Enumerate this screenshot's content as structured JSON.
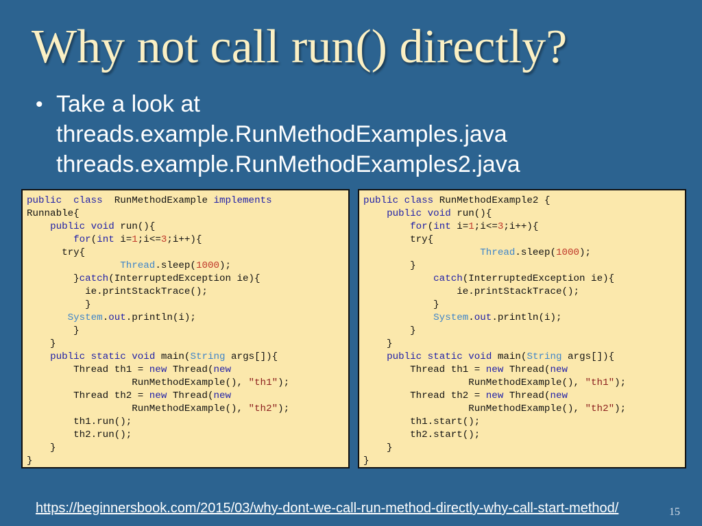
{
  "slide": {
    "title": "Why not call run() directly?",
    "bullet": {
      "lines": [
        "Take a look at",
        "threads.example.RunMethodExamples.java",
        "threads.example.RunMethodExamples2.java"
      ]
    },
    "footer_link": "https://beginnersbook.com/2015/03/why-dont-we-call-run-method-directly-why-call-start-method/",
    "page_number": "15"
  },
  "code_left": [
    [
      [
        "kw",
        "public"
      ],
      [
        "",
        "  "
      ],
      [
        "kw",
        "class"
      ],
      [
        "",
        "  RunMethodExample "
      ],
      [
        "kw",
        "implements"
      ]
    ],
    [
      [
        "",
        "Runnable{"
      ]
    ],
    [
      [
        "",
        "    "
      ],
      [
        "kw",
        "public"
      ],
      [
        "",
        " "
      ],
      [
        "kw",
        "void"
      ],
      [
        "",
        " run(){"
      ]
    ],
    [
      [
        "",
        "        "
      ],
      [
        "kw",
        "for"
      ],
      [
        "",
        "("
      ],
      [
        "kw",
        "int"
      ],
      [
        "",
        " i="
      ],
      [
        "num",
        "1"
      ],
      [
        "",
        ";i<="
      ],
      [
        "num",
        "3"
      ],
      [
        "",
        ";i++){"
      ]
    ],
    [
      [
        "",
        "      try{"
      ]
    ],
    [
      [
        "",
        "                "
      ],
      [
        "tp",
        "Thread"
      ],
      [
        "",
        ".sleep("
      ],
      [
        "num",
        "1000"
      ],
      [
        "",
        ");"
      ]
    ],
    [
      [
        "",
        "        }"
      ],
      [
        "kw",
        "catch"
      ],
      [
        "",
        "(InterruptedException ie){"
      ]
    ],
    [
      [
        "",
        "          ie.printStackTrace();"
      ]
    ],
    [
      [
        "",
        "          }"
      ]
    ],
    [
      [
        "",
        "       "
      ],
      [
        "tp",
        "System"
      ],
      [
        "",
        "."
      ],
      [
        "fld",
        "out"
      ],
      [
        "",
        ".println(i);"
      ]
    ],
    [
      [
        "",
        "        }"
      ]
    ],
    [
      [
        "",
        "    }"
      ]
    ],
    [
      [
        "",
        "    "
      ],
      [
        "kw",
        "public"
      ],
      [
        "",
        " "
      ],
      [
        "kw",
        "static"
      ],
      [
        "",
        " "
      ],
      [
        "kw",
        "void"
      ],
      [
        "",
        " main("
      ],
      [
        "tp",
        "String"
      ],
      [
        "",
        " args[]){"
      ]
    ],
    [
      [
        "",
        "        Thread th1 = "
      ],
      [
        "kw",
        "new"
      ],
      [
        "",
        " Thread("
      ],
      [
        "kw",
        "new"
      ]
    ],
    [
      [
        "",
        "                  RunMethodExample(), "
      ],
      [
        "str",
        "\"th1\""
      ],
      [
        "",
        ");"
      ]
    ],
    [
      [
        "",
        "        Thread th2 = "
      ],
      [
        "kw",
        "new"
      ],
      [
        "",
        " Thread("
      ],
      [
        "kw",
        "new"
      ]
    ],
    [
      [
        "",
        "                  RunMethodExample(), "
      ],
      [
        "str",
        "\"th2\""
      ],
      [
        "",
        ");"
      ]
    ],
    [
      [
        "",
        "        th1.run();"
      ]
    ],
    [
      [
        "",
        "        th2.run();"
      ]
    ],
    [
      [
        "",
        "    }"
      ]
    ],
    [
      [
        "",
        "}"
      ]
    ]
  ],
  "code_right": [
    [
      [
        "kw",
        "public"
      ],
      [
        "",
        " "
      ],
      [
        "kw",
        "class"
      ],
      [
        "",
        " RunMethodExample2 {"
      ]
    ],
    [
      [
        "",
        "    "
      ],
      [
        "kw",
        "public"
      ],
      [
        "",
        " "
      ],
      [
        "kw",
        "void"
      ],
      [
        "",
        " run(){"
      ]
    ],
    [
      [
        "",
        "        "
      ],
      [
        "kw",
        "for"
      ],
      [
        "",
        "("
      ],
      [
        "kw",
        "int"
      ],
      [
        "",
        " i="
      ],
      [
        "num",
        "1"
      ],
      [
        "",
        ";i<="
      ],
      [
        "num",
        "3"
      ],
      [
        "",
        ";i++){"
      ]
    ],
    [
      [
        "",
        "        try{"
      ]
    ],
    [
      [
        "",
        "                    "
      ],
      [
        "tp",
        "Thread"
      ],
      [
        "",
        ".sleep("
      ],
      [
        "num",
        "1000"
      ],
      [
        "",
        ");"
      ]
    ],
    [
      [
        "",
        "        }"
      ]
    ],
    [
      [
        "",
        "            "
      ],
      [
        "kw",
        "catch"
      ],
      [
        "",
        "(InterruptedException ie){"
      ]
    ],
    [
      [
        "",
        "                ie.printStackTrace();"
      ]
    ],
    [
      [
        "",
        "            }"
      ]
    ],
    [
      [
        "",
        "            "
      ],
      [
        "tp",
        "System"
      ],
      [
        "",
        "."
      ],
      [
        "fld",
        "out"
      ],
      [
        "",
        ".println(i);"
      ]
    ],
    [
      [
        "",
        "        }"
      ]
    ],
    [
      [
        "",
        "    }"
      ]
    ],
    [
      [
        "",
        "    "
      ],
      [
        "kw",
        "public"
      ],
      [
        "",
        " "
      ],
      [
        "kw",
        "static"
      ],
      [
        "",
        " "
      ],
      [
        "kw",
        "void"
      ],
      [
        "",
        " main("
      ],
      [
        "tp",
        "String"
      ],
      [
        "",
        " args[]){"
      ]
    ],
    [
      [
        "",
        "        Thread th1 = "
      ],
      [
        "kw",
        "new"
      ],
      [
        "",
        " Thread("
      ],
      [
        "kw",
        "new"
      ]
    ],
    [
      [
        "",
        "                  RunMethodExample(), "
      ],
      [
        "str",
        "\"th1\""
      ],
      [
        "",
        ");"
      ]
    ],
    [
      [
        "",
        "        Thread th2 = "
      ],
      [
        "kw",
        "new"
      ],
      [
        "",
        " Thread("
      ],
      [
        "kw",
        "new"
      ]
    ],
    [
      [
        "",
        "                  RunMethodExample(), "
      ],
      [
        "str",
        "\"th2\""
      ],
      [
        "",
        ");"
      ]
    ],
    [
      [
        "",
        "        th1.start();"
      ]
    ],
    [
      [
        "",
        "        th2.start();"
      ]
    ],
    [
      [
        "",
        "    }"
      ]
    ],
    [
      [
        "",
        "}"
      ]
    ]
  ]
}
